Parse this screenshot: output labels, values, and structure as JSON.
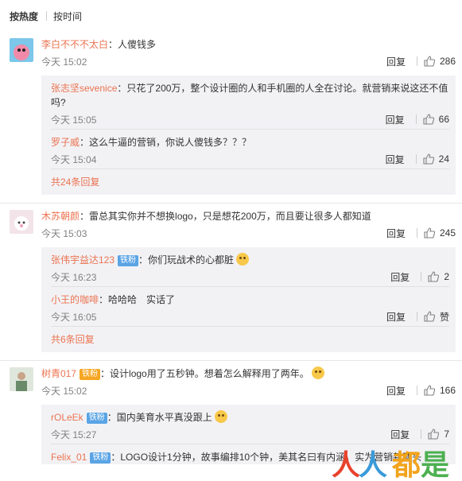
{
  "sort": {
    "hot": "按热度",
    "time": "按时间"
  },
  "comments": [
    {
      "user": "李白不不不太白",
      "text": "人傻钱多",
      "time": "今天 15:02",
      "reply_label": "回复",
      "likes": "286",
      "replies": [
        {
          "user": "张志坚sevenice",
          "text": "只花了200万，整个设计圈的人和手机圈的人全在讨论。就营销来说这还不值吗?",
          "time": "今天 15:05",
          "reply_label": "回复",
          "likes": "66"
        },
        {
          "user": "罗子威",
          "text": "这么牛逼的营销，你说人傻钱多？？？",
          "time": "今天 15:04",
          "reply_label": "回复",
          "likes": "24"
        }
      ],
      "more": "共24条回复"
    },
    {
      "user": "木苏朝颜",
      "text": "雷总其实你并不想换logo，只是想花200万，而且要让很多人都知道",
      "time": "今天 15:03",
      "reply_label": "回复",
      "likes": "245",
      "replies": [
        {
          "user": "张伟宇益达123",
          "badge": "铁粉",
          "text": "你们玩战术的心都脏",
          "time": "今天 16:23",
          "reply_label": "回复",
          "likes": "2"
        },
        {
          "user": "小王的咖啡",
          "text": "哈哈哈　实话了",
          "time": "今天 16:05",
          "reply_label": "回复",
          "likes": "赞"
        }
      ],
      "more": "共6条回复"
    },
    {
      "user": "树青017",
      "badge": "铁粉",
      "text": "设计logo用了五秒钟。想着怎么解释用了两年。",
      "time": "今天 15:02",
      "reply_label": "回复",
      "likes": "166",
      "replies": [
        {
          "user": "rOLeEk",
          "badge": "铁粉",
          "text": "国内美育水平真没跟上",
          "time": "今天 15:27",
          "reply_label": "回复",
          "likes": "7"
        },
        {
          "user": "Felix_01",
          "badge": "铁粉",
          "text": "LOGO设计1分钟，故事编排10个钟，美其名曰有内涵，实为营销新噱头"
        }
      ]
    }
  ],
  "watermark": {
    "chars": [
      "人",
      "人",
      "都",
      "是"
    ]
  }
}
